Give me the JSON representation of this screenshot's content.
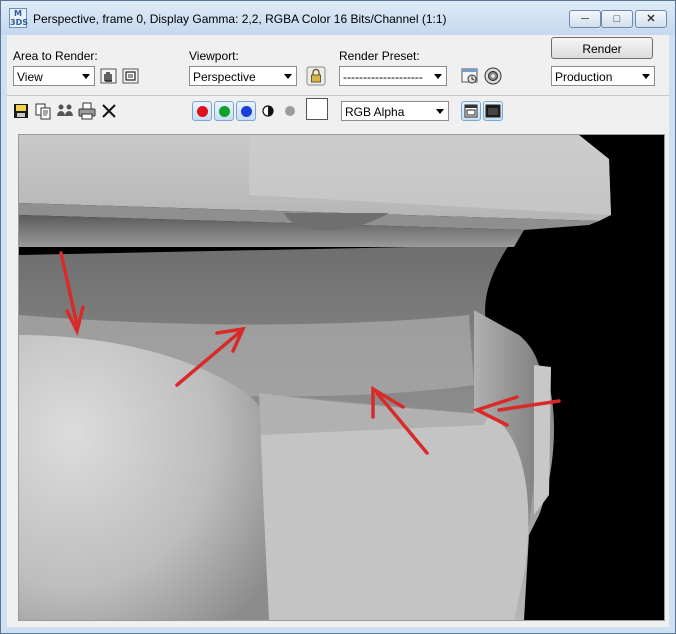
{
  "window": {
    "title": "Perspective, frame 0, Display Gamma: 2,2, RGBA Color 16 Bits/Channel (1:1)",
    "app_icon_text": "M 3DS"
  },
  "controls": {
    "area_to_render_label": "Area to Render:",
    "area_to_render_value": "View",
    "viewport_label": "Viewport:",
    "viewport_value": "Perspective",
    "render_preset_label": "Render Preset:",
    "render_preset_value": "--------------------",
    "render_button": "Render",
    "production_value": "Production"
  },
  "toolbar": {
    "channel_display_value": "RGB Alpha"
  },
  "colors": {
    "red_channel": "#e0101a",
    "green_channel": "#11a02c",
    "blue_channel": "#1a3fd8",
    "annotation_red": "#d92a2a"
  }
}
